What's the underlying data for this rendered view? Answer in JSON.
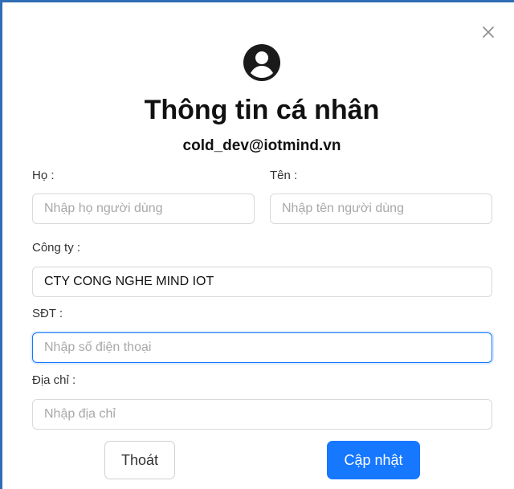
{
  "profile": {
    "title": "Thông tin cá nhân",
    "email": "cold_dev@iotmind.vn"
  },
  "form": {
    "last_name_label": "Họ :",
    "last_name_placeholder": "Nhập họ người dùng",
    "last_name_value": "",
    "first_name_label": "Tên :",
    "first_name_placeholder": "Nhập tên người dùng",
    "first_name_value": "",
    "company_label": "Công ty :",
    "company_placeholder": "",
    "company_value": "CTY CONG NGHE MIND IOT",
    "phone_label": "SĐT :",
    "phone_placeholder": "Nhập số điện thoại",
    "phone_value": "",
    "address_label": "Địa chỉ :",
    "address_placeholder": "Nhập địa chỉ",
    "address_value": ""
  },
  "actions": {
    "cancel_label": "Thoát",
    "submit_label": "Cập nhật"
  },
  "icons": {
    "close": "close-icon",
    "avatar": "user-circle-icon"
  },
  "colors": {
    "primary": "#1677ff",
    "frame": "#2f6db5"
  }
}
